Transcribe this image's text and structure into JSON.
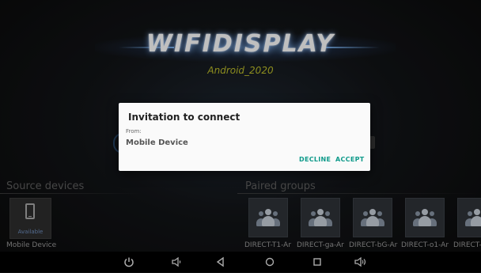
{
  "app": {
    "logo_title": "WIFIDISPLAY",
    "logo_subtitle": "Android_2020"
  },
  "sections": {
    "source_label": "Source devices",
    "paired_label": "Paired groups"
  },
  "source_devices": [
    {
      "name": "Mobile Device",
      "status": "Available",
      "icon": "phone-icon"
    }
  ],
  "paired_groups": [
    {
      "name": "DIRECT-T1-Ar",
      "icon": "people-icon"
    },
    {
      "name": "DIRECT-ga-Ar",
      "icon": "people-icon"
    },
    {
      "name": "DIRECT-bG-Ar",
      "icon": "people-icon"
    },
    {
      "name": "DIRECT-o1-Ar",
      "icon": "people-icon"
    },
    {
      "name": "DIRECT-",
      "icon": "people-icon"
    }
  ],
  "dialog": {
    "title": "Invitation to connect",
    "from_label": "From:",
    "device": "Mobile Device",
    "decline_label": "DECLINE",
    "accept_label": "ACCEPT"
  },
  "navbar": {
    "items": [
      "power-icon",
      "volume-down-icon",
      "back-icon",
      "home-icon",
      "recents-icon",
      "volume-up-icon"
    ]
  },
  "colors": {
    "accent": "#0e9a8a",
    "subtitle": "#bdbd2a",
    "available": "#6f8fc0"
  }
}
